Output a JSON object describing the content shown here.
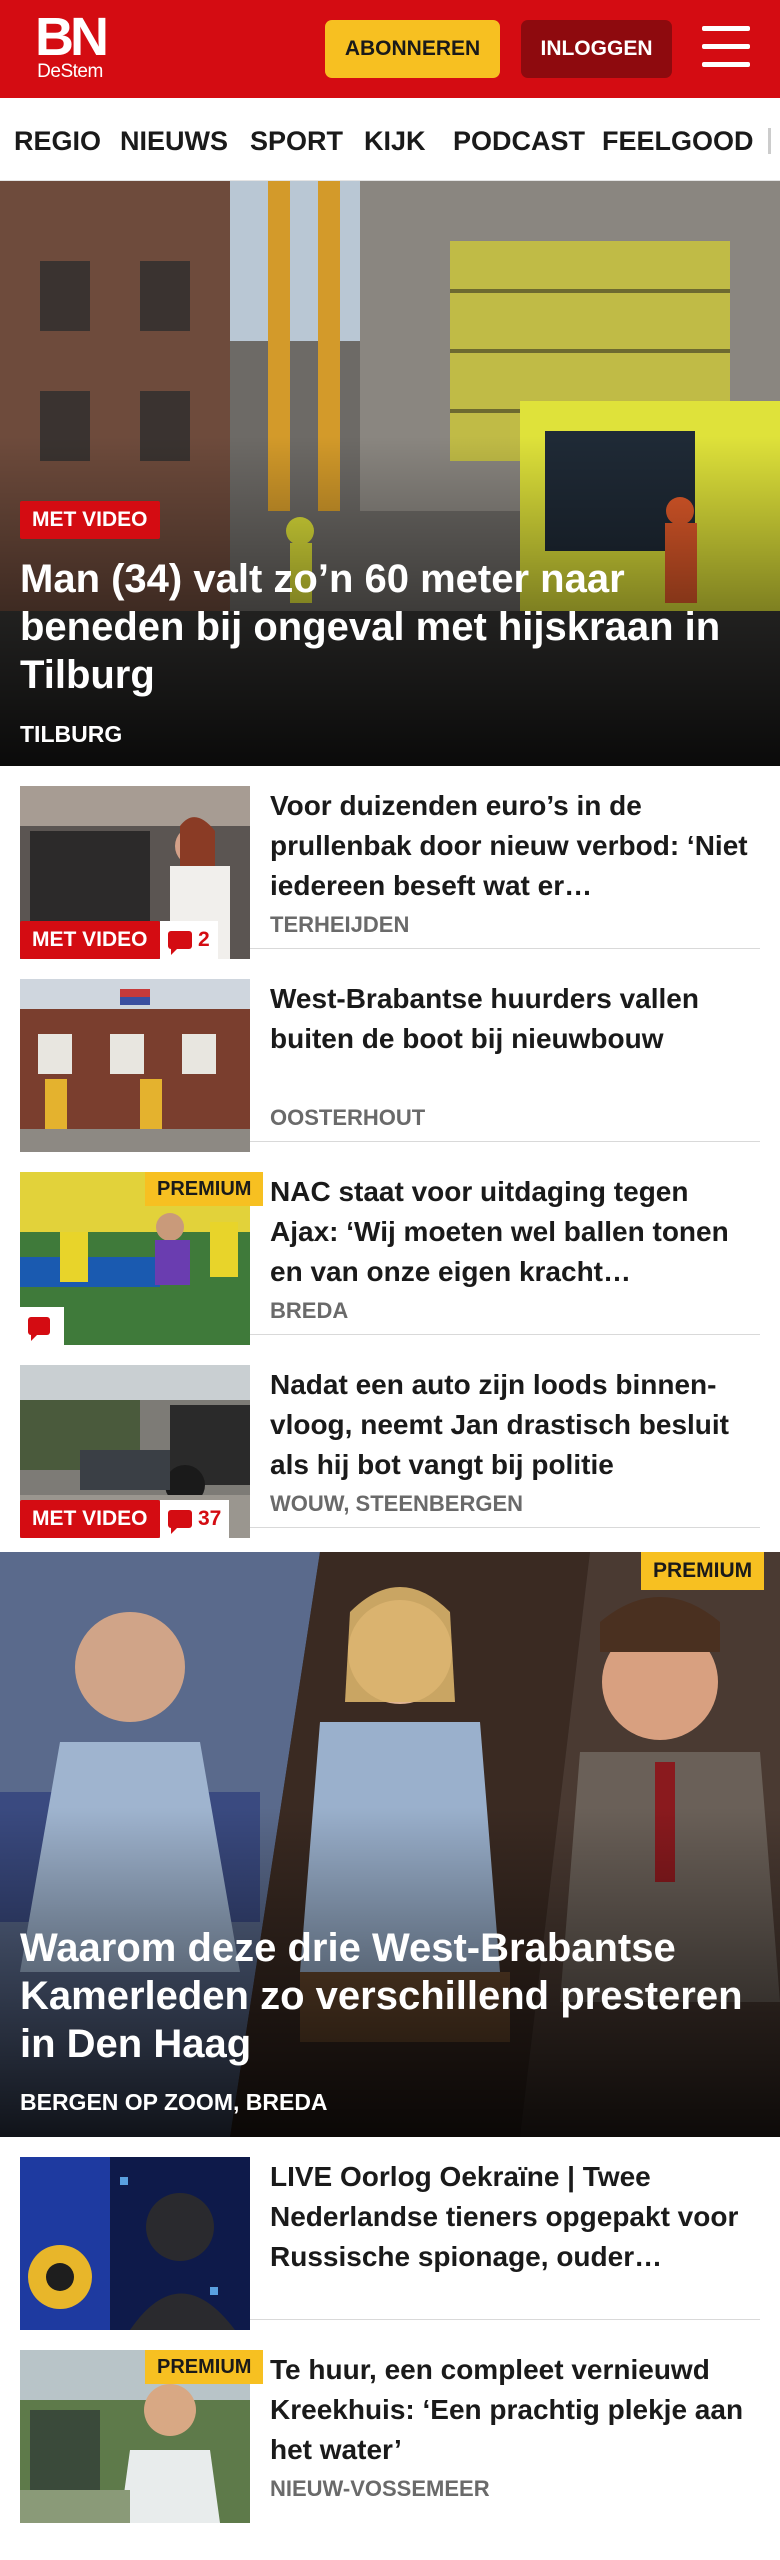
{
  "header": {
    "logo_main": "BN",
    "logo_sub": "DeStem",
    "subscribe_label": "ABONNEREN",
    "login_label": "INLOGGEN",
    "menu_icon": "hamburger-menu-icon",
    "colors": {
      "brand_red": "#d40c12",
      "subscribe_yellow": "#f7c021",
      "login_dark_red": "#8e0a0e"
    }
  },
  "nav": {
    "items": [
      "REGIO",
      "NIEUWS",
      "SPORT",
      "KIJK",
      "PODCAST",
      "FEELGOOD"
    ]
  },
  "hero": {
    "badge": "MET VIDEO",
    "title": "Man (34) valt zo’n 60 meter naar beneden bij ongeval met hijskraan in Tilburg",
    "location": "TILBURG"
  },
  "articles": [
    {
      "title": "Voor duizenden euro’s in de prullenbak door nieuw verbod: ‘Niet iedereen beseft wat er…",
      "location": "TERHEIJDEN",
      "badge": "MET VIDEO",
      "comments": "2"
    },
    {
      "title": "West-Brabantse huurders vallen buiten de boot bij nieuwbouw",
      "location": "OOSTERHOUT"
    },
    {
      "title": "NAC staat voor uitdaging tegen Ajax: ‘Wij moeten wel ballen tonen en van onze eigen kracht…",
      "location": "BREDA",
      "premium": "PREMIUM",
      "comments": ""
    },
    {
      "title": "Nadat een auto zijn loods binnen­vloog, neemt Jan drastisch besluit als hij bot vangt bij politie",
      "location": "WOUW, STEENBERGEN",
      "badge": "MET VIDEO",
      "comments": "37"
    }
  ],
  "feature": {
    "premium": "PREMIUM",
    "title": "Waarom deze drie West-Brabantse Kamerleden zo verschillend presteren in Den Haag",
    "location": "BERGEN OP ZOOM, BREDA"
  },
  "articles2": [
    {
      "title": "LIVE Oorlog Oekraïne | Twee Nederlandse tieners opgepakt voor Russische spionage, ouder…"
    },
    {
      "title": "Te huur, een compleet vernieuwd Kreekhuis: ‘Een prachtig plekje aan het water’",
      "location": "NIEUW-VOSSEMEER",
      "premium": "PREMIUM"
    }
  ]
}
